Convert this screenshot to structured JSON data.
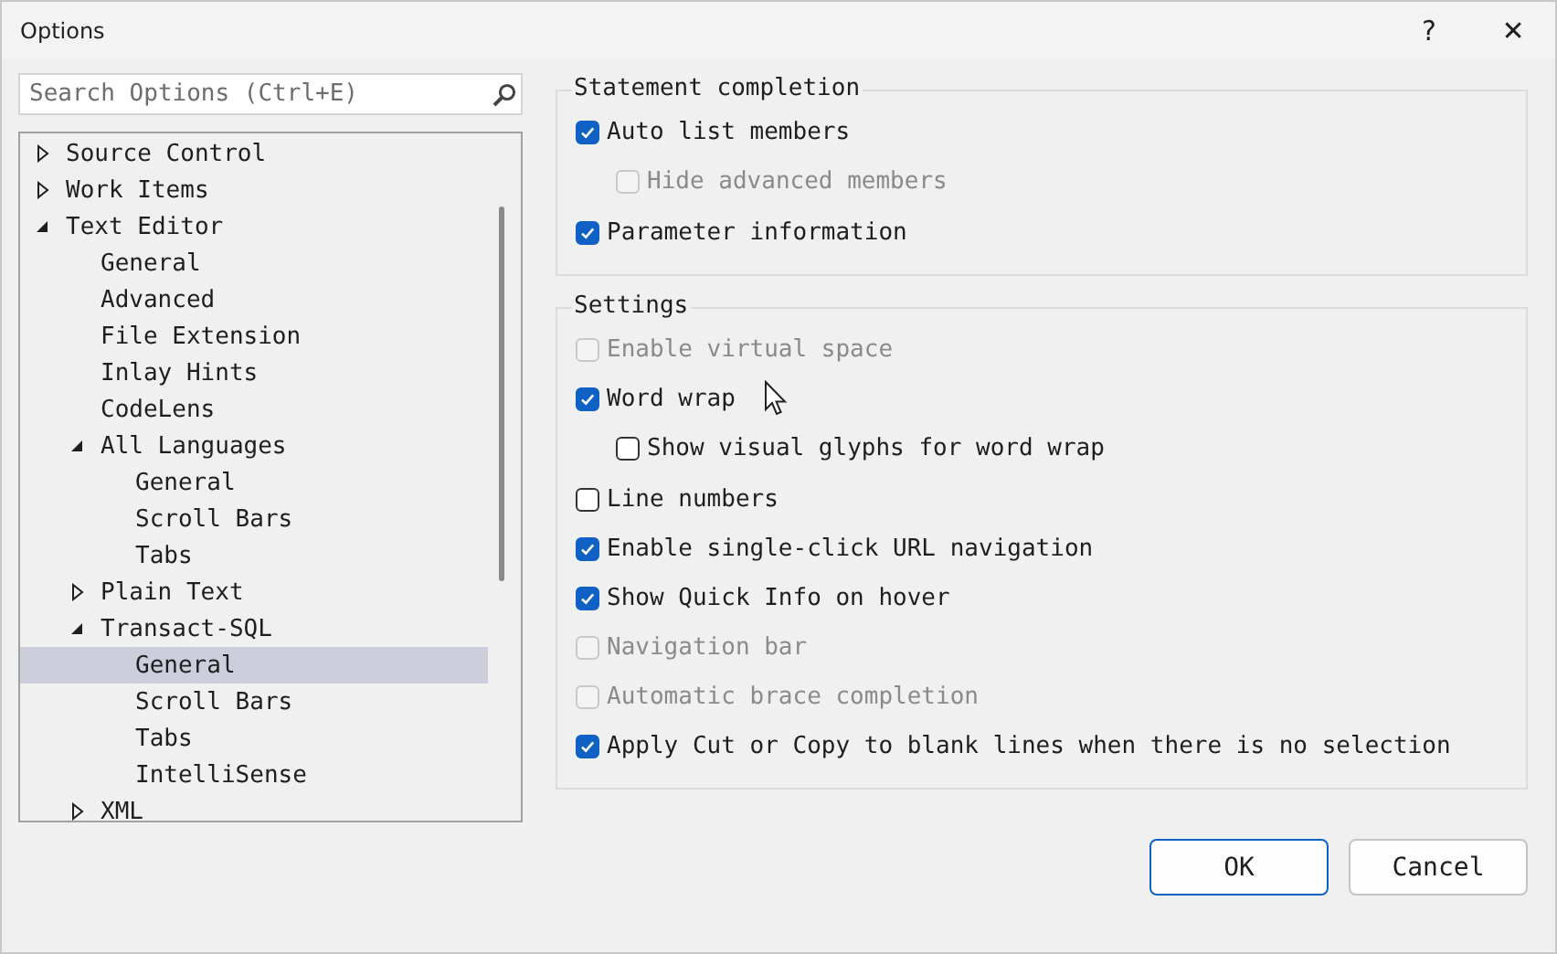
{
  "window": {
    "title": "Options",
    "help": "?",
    "close": "✕"
  },
  "search": {
    "placeholder": "Search Options (Ctrl+E)"
  },
  "tree": [
    {
      "label": "Source Control",
      "expanded": false,
      "selected": false
    },
    {
      "label": "Work Items",
      "expanded": false,
      "selected": false
    },
    {
      "label": "Text Editor",
      "expanded": true,
      "selected": false,
      "children": [
        {
          "label": "General",
          "selected": false
        },
        {
          "label": "Advanced",
          "selected": false
        },
        {
          "label": "File Extension",
          "selected": false
        },
        {
          "label": "Inlay Hints",
          "selected": false
        },
        {
          "label": "CodeLens",
          "selected": false
        },
        {
          "label": "All Languages",
          "expanded": true,
          "selected": false,
          "children": [
            {
              "label": "General",
              "selected": false
            },
            {
              "label": "Scroll Bars",
              "selected": false
            },
            {
              "label": "Tabs",
              "selected": false
            }
          ]
        },
        {
          "label": "Plain Text",
          "expanded": false,
          "selected": false
        },
        {
          "label": "Transact-SQL",
          "expanded": true,
          "selected": false,
          "children": [
            {
              "label": "General",
              "selected": true
            },
            {
              "label": "Scroll Bars",
              "selected": false
            },
            {
              "label": "Tabs",
              "selected": false
            },
            {
              "label": "IntelliSense",
              "selected": false
            }
          ]
        },
        {
          "label": "XML",
          "expanded": false,
          "selected": false
        }
      ]
    }
  ],
  "groups": [
    {
      "title": "Statement completion",
      "options": [
        {
          "label": "Auto list members",
          "checked": true,
          "disabled": false,
          "children": [
            {
              "label": "Hide advanced members",
              "checked": false,
              "disabled": true
            }
          ]
        },
        {
          "label": "Parameter information",
          "checked": true,
          "disabled": false
        }
      ]
    },
    {
      "title": "Settings",
      "options": [
        {
          "label": "Enable virtual space",
          "checked": false,
          "disabled": true
        },
        {
          "label": "Word wrap",
          "checked": true,
          "disabled": false,
          "children": [
            {
              "label": "Show visual glyphs for word wrap",
              "checked": false,
              "disabled": false
            }
          ]
        },
        {
          "label": "Line numbers",
          "checked": false,
          "disabled": false
        },
        {
          "label": "Enable single-click URL navigation",
          "checked": true,
          "disabled": false
        },
        {
          "label": "Show Quick Info on hover",
          "checked": true,
          "disabled": false
        },
        {
          "label": "Navigation bar",
          "checked": false,
          "disabled": true
        },
        {
          "label": "Automatic brace completion",
          "checked": false,
          "disabled": true
        },
        {
          "label": "Apply Cut or Copy to blank lines when there is no selection",
          "checked": true,
          "disabled": false
        }
      ]
    }
  ],
  "buttons": [
    {
      "label": "OK",
      "default": true
    },
    {
      "label": "Cancel",
      "default": false
    }
  ]
}
